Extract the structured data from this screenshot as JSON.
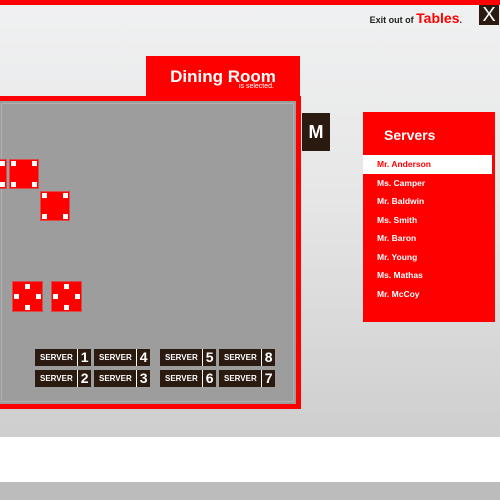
{
  "header": {
    "exit_prefix": "Exit out of",
    "exit_target": "Tables",
    "exit_suffix": ".",
    "close_label": "X"
  },
  "room": {
    "name": "Dining Room",
    "status": "is selected."
  },
  "mode_button": "M",
  "tables": [
    {
      "id": "table-1",
      "shape": "square",
      "seats": 4,
      "seat_layout": "corners"
    },
    {
      "id": "table-2",
      "shape": "square",
      "seats": 4,
      "seat_layout": "corners"
    },
    {
      "id": "table-3",
      "shape": "square",
      "seats": 4,
      "seat_layout": "corners"
    },
    {
      "id": "table-4",
      "shape": "square",
      "seats": 4,
      "seat_layout": "sides"
    },
    {
      "id": "table-5",
      "shape": "square",
      "seats": 4,
      "seat_layout": "sides"
    }
  ],
  "server_buttons": [
    {
      "label": "SERVER",
      "number": "1"
    },
    {
      "label": "SERVER",
      "number": "4"
    },
    {
      "label": "SERVER",
      "number": "2"
    },
    {
      "label": "SERVER",
      "number": "3"
    },
    {
      "label": "SERVER",
      "number": "5"
    },
    {
      "label": "SERVER",
      "number": "8"
    },
    {
      "label": "SERVER",
      "number": "6"
    },
    {
      "label": "SERVER",
      "number": "7"
    }
  ],
  "servers_panel": {
    "title": "Servers",
    "selected": "Mr. Anderson",
    "items": [
      "Mr. Anderson",
      "Ms. Camper",
      "Mr. Baldwin",
      "Ms. Smith",
      "Mr. Baron",
      "Mr. Young",
      "Ms. Mathas",
      "Mr. McCoy"
    ]
  },
  "colors": {
    "accent": "#ff0000",
    "dark": "#2b1a10",
    "floor": "#9d9d9d"
  }
}
